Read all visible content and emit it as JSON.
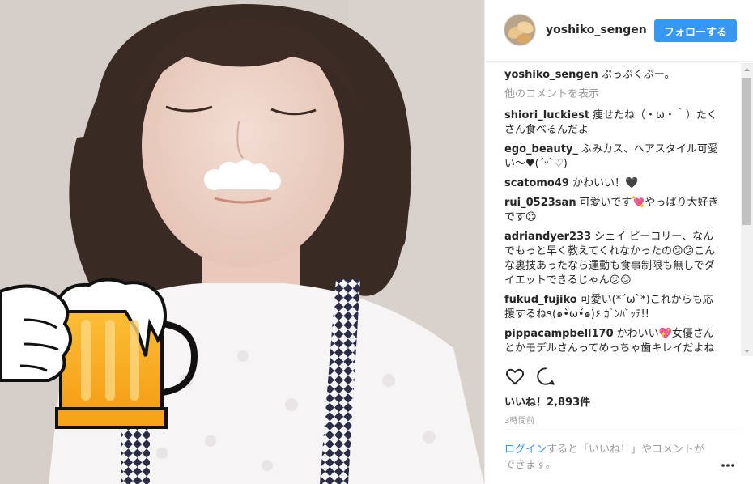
{
  "post": {
    "username": "yoshiko_sengen",
    "follow_label": "フォローする",
    "caption_text": "ぷっぷくぷー。",
    "view_more_label": "他のコメントを表示",
    "comments": [
      {
        "user": "shiori_luckiest",
        "text": "痩せたね（・ω・｀）たくさん食べるんだよ"
      },
      {
        "user": "ego_beauty_",
        "text": "ふみカス、ヘアスタイル可愛い〜♥(ˊᵕˋ♡)"
      },
      {
        "user": "scatomo49",
        "text": "かわいい！🖤"
      },
      {
        "user": "rui_0523san",
        "text": "可愛いです💘やっぱり大好きです☺"
      },
      {
        "user": "adriandyer233",
        "text": "シェイ ピーコリー、なんでもっと早く教えてくれなかったの😕😕こんな裏技あったなら運動も食事制限も無しでダイエットできるじゃん😕😕"
      },
      {
        "user": "fukud_fujiko",
        "text": "可愛い(*´ω`*)これからも応援するね٩(๑•̀ω•́๑)۶ ｶﾞﾝﾊﾞｯﾃ!!"
      },
      {
        "user": "pippacampbell170",
        "text": "かわいい💖女優さんとかモデルさんってめっちゃ歯キレイだよね"
      }
    ],
    "likes_label": "いいね！2,893件",
    "timestamp": "3時間前",
    "login_link": "ログイン",
    "login_rest": "すると「いいね！」やコメントができます。",
    "more_icon": "more-dots-icon"
  },
  "colors": {
    "accent": "#3897f0",
    "text": "#262626",
    "muted": "#999999"
  }
}
